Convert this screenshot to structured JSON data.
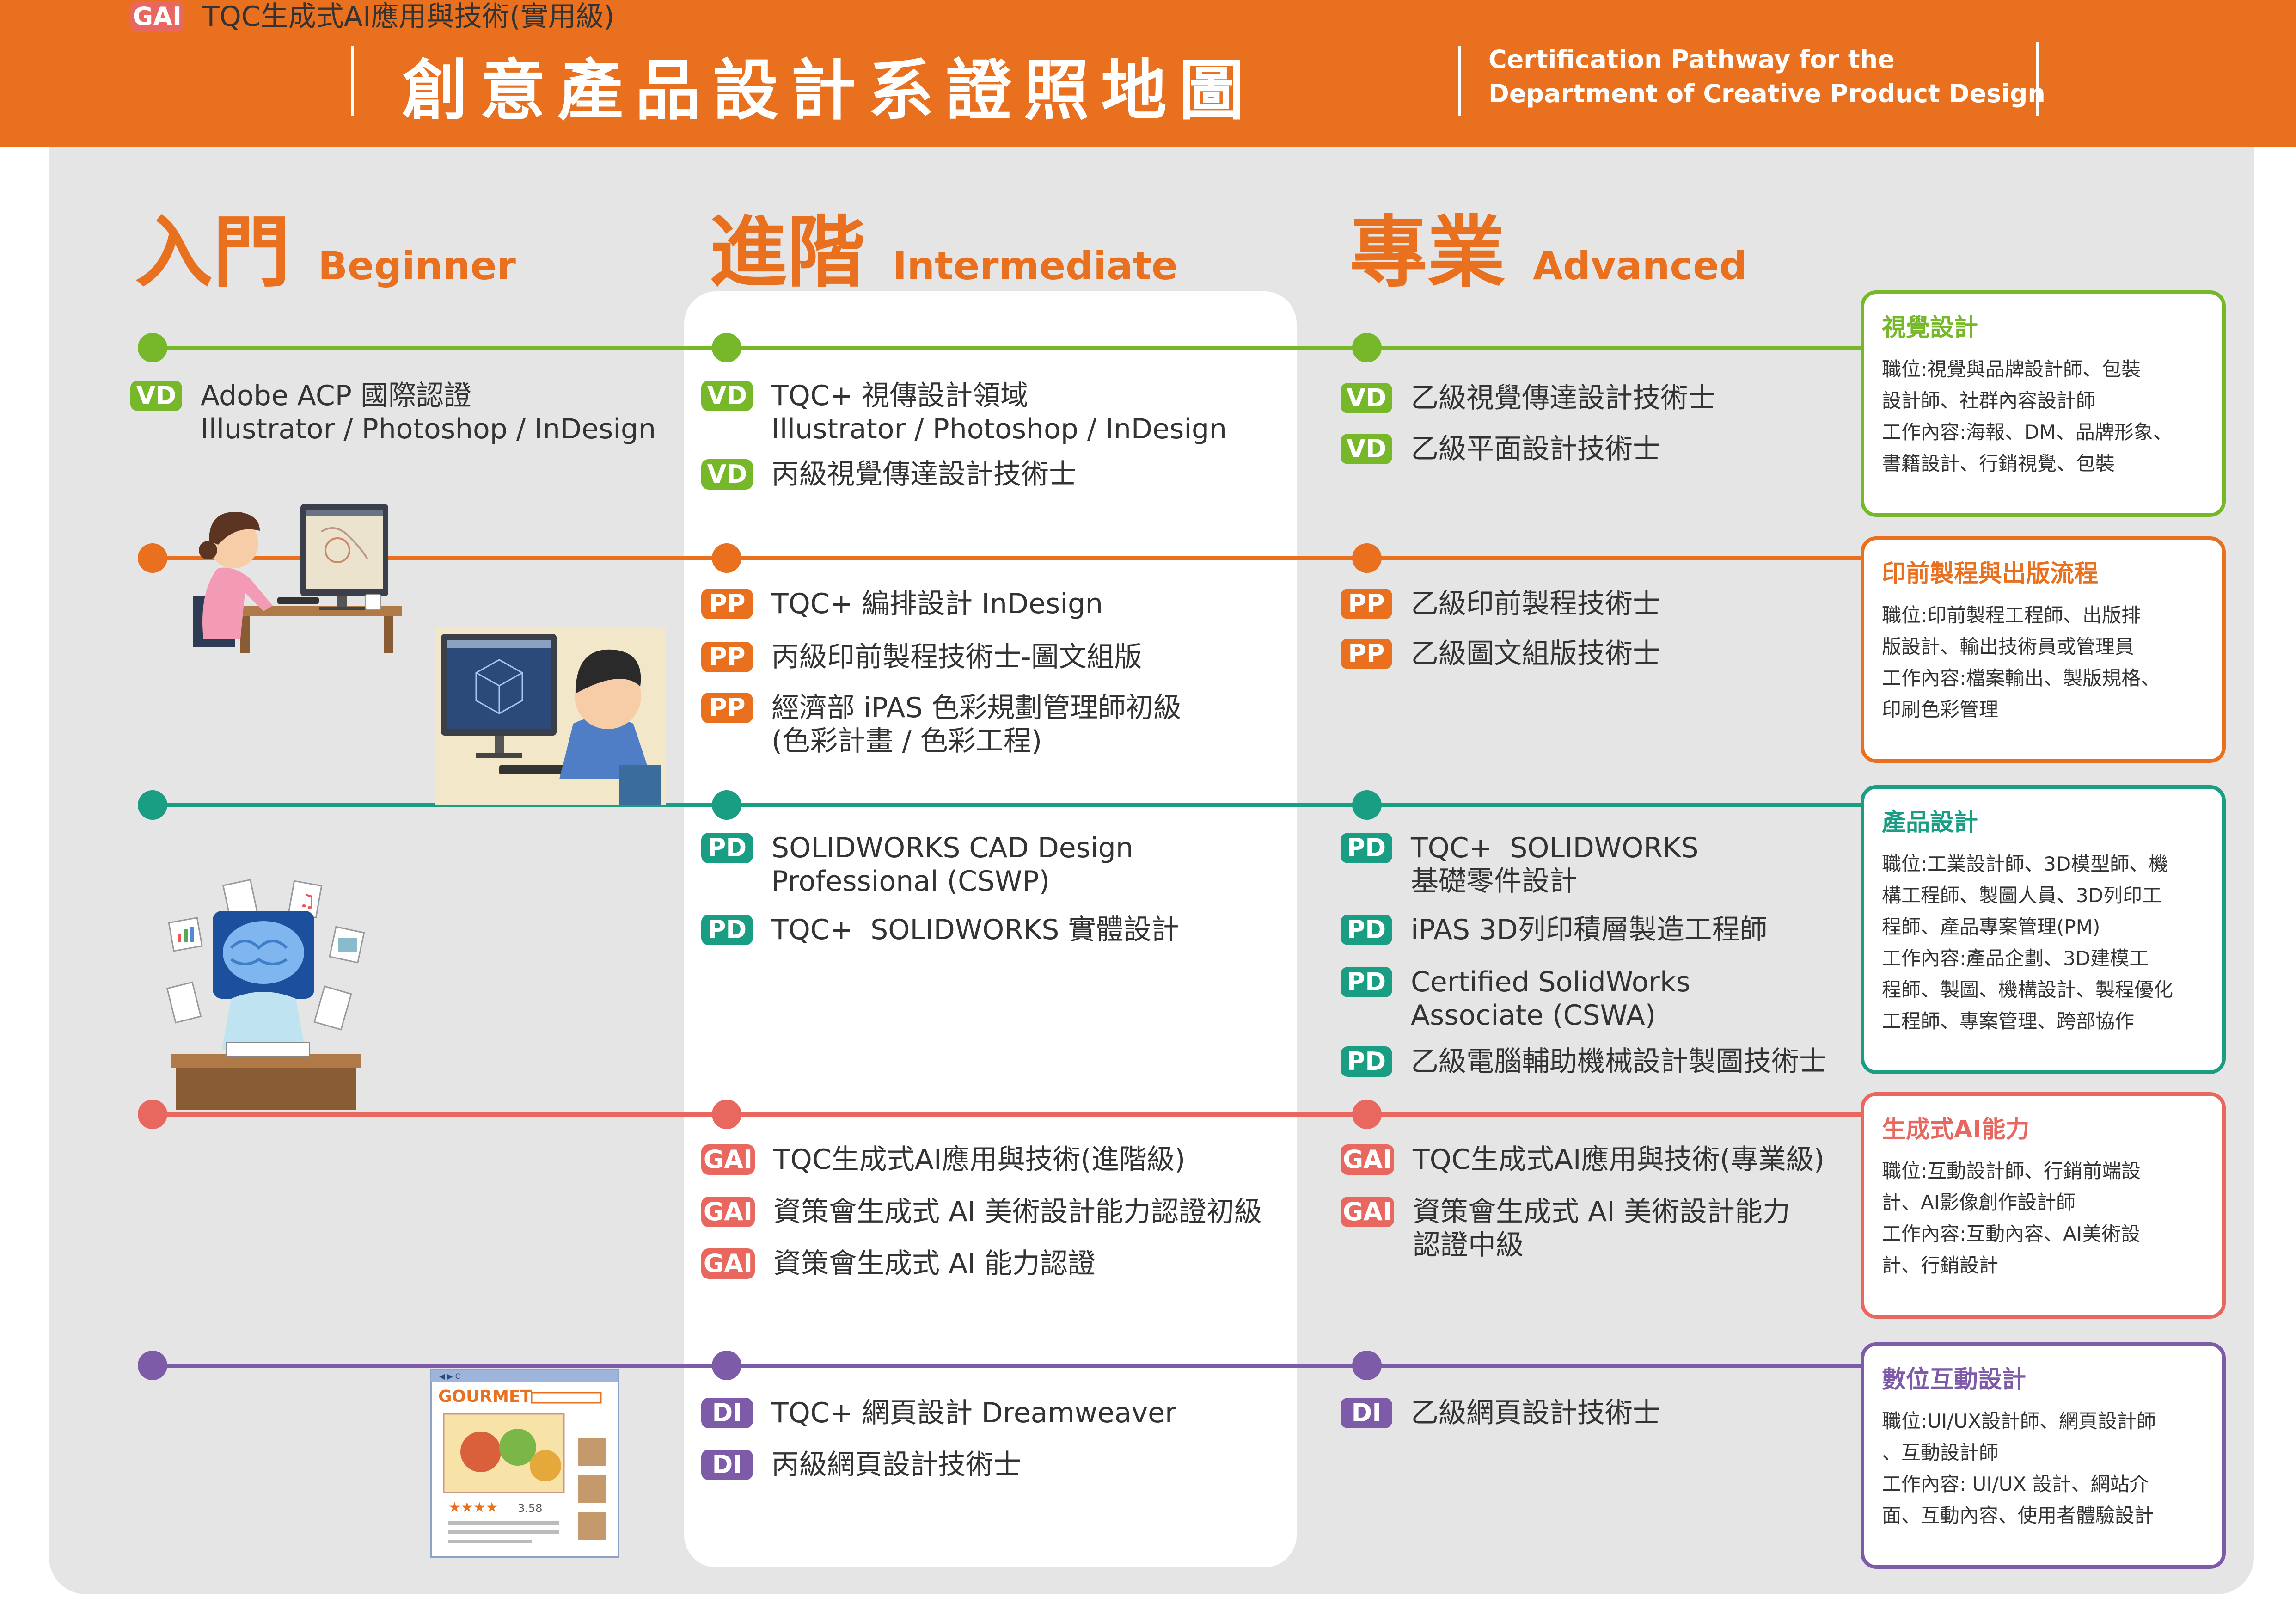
{
  "header": {
    "title": "創意產品設計系證照地圖",
    "subtitle_en": "Certification Pathway for the\nDepartment of Creative Product Design"
  },
  "levels": [
    {
      "zh": "入門",
      "en": "Beginner"
    },
    {
      "zh": "進階",
      "en": "Intermediate"
    },
    {
      "zh": "專業",
      "en": "Advanced"
    }
  ],
  "colors": {
    "header": "#E8701F",
    "VD": "#76B82A",
    "PP": "#E8701F",
    "PD": "#1A9E83",
    "GAI": "#E8675F",
    "DI": "#7E5BA8"
  },
  "tracks": [
    {
      "code": "VD",
      "beginner": [
        "Adobe ACP 國際認證\nIllustrator / Photoshop / InDesign"
      ],
      "intermediate": [
        "TQC+ 視傳設計領域\nIllustrator / Photoshop / InDesign",
        "丙級視覺傳達設計技術士"
      ],
      "advanced": [
        "乙級視覺傳達設計技術士",
        "乙級平面設計技術士"
      ],
      "box": {
        "title": "視覺設計",
        "lines": [
          "職位:視覺與品牌設計師、包裝",
          "設計師、社群內容設計師",
          "工作內容:海報、DM、品牌形象、",
          "書籍設計、行銷視覺、包裝"
        ]
      }
    },
    {
      "code": "PP",
      "beginner": [],
      "intermediate": [
        "TQC+ 編排設計 InDesign",
        "丙級印前製程技術士-圖文組版",
        "經濟部 iPAS 色彩規劃管理師初級\n(色彩計畫 / 色彩工程)"
      ],
      "advanced": [
        "乙級印前製程技術士",
        "乙級圖文組版技術士"
      ],
      "box": {
        "title": "印前製程與出版流程",
        "lines": [
          "職位:印前製程工程師、出版排",
          "版設計、輸出技術員或管理員",
          "工作內容:檔案輸出、製版規格、",
          "印刷色彩管理"
        ]
      }
    },
    {
      "code": "PD",
      "beginner": [],
      "intermediate": [
        "SOLIDWORKS CAD Design\nProfessional (CSWP)",
        "TQC+  SOLIDWORKS 實體設計"
      ],
      "advanced": [
        "TQC+  SOLIDWORKS\n基礎零件設計",
        "iPAS 3D列印積層製造工程師",
        "Certified SolidWorks\nAssociate (CSWA)",
        "乙級電腦輔助機械設計製圖技術士"
      ],
      "box": {
        "title": "產品設計",
        "lines": [
          "職位:工業設計師、3D模型師、機",
          "構工程師、製圖人員、3D列印工",
          "程師、產品專案管理(PM)",
          "工作內容:產品企劃、3D建模工",
          "程師、製圖、機構設計、製程優化",
          "工程師、專案管理、跨部協作"
        ]
      }
    },
    {
      "code": "GAI",
      "beginner": [
        "TQC生成式AI應用與技術(實用級)"
      ],
      "intermediate": [
        "TQC生成式AI應用與技術(進階級)",
        "資策會生成式 AI 美術設計能力認證初級",
        "資策會生成式 AI 能力認證"
      ],
      "advanced": [
        "TQC生成式AI應用與技術(專業級)",
        "資策會生成式 AI 美術設計能力\n認證中級"
      ],
      "box": {
        "title": "生成式AI能力",
        "lines": [
          "職位:互動設計師、行銷前端設",
          "計、AI影像創作設計師",
          "工作內容:互動內容、AI美術設",
          "計、行銷設計"
        ]
      }
    },
    {
      "code": "DI",
      "beginner": [],
      "intermediate": [
        "TQC+ 網頁設計 Dreamweaver",
        "丙級網頁設計技術士"
      ],
      "advanced": [
        "乙級網頁設計技術士"
      ],
      "box": {
        "title": "數位互動設計",
        "lines": [
          "職位:UI/UX設計師、網頁設計師",
          "、互動設計師",
          "工作內容: UI/UX 設計、網站介",
          "面、互動內容、使用者體驗設計"
        ]
      }
    }
  ],
  "illustrations": {
    "gourmet_title": "GOURMET",
    "gourmet_rating": "3.58"
  }
}
